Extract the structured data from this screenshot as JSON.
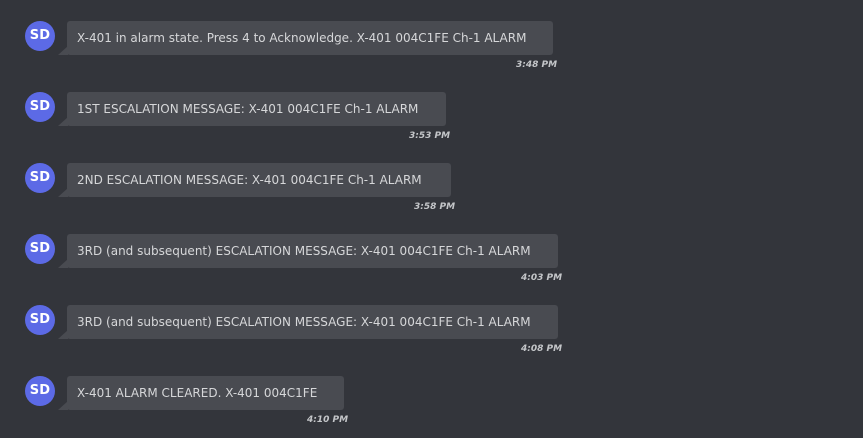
{
  "messages": [
    {
      "avatar": "SD",
      "text": "X-401 in alarm state. Press 4 to Acknowledge. X-401 004C1FE Ch-1 ALARM",
      "time": "3:48 PM"
    },
    {
      "avatar": "SD",
      "text": "1ST ESCALATION MESSAGE: X-401 004C1FE Ch-1 ALARM",
      "time": "3:53 PM"
    },
    {
      "avatar": "SD",
      "text": "2ND ESCALATION MESSAGE: X-401 004C1FE Ch-1 ALARM",
      "time": "3:58 PM"
    },
    {
      "avatar": "SD",
      "text": "3RD (and subsequent) ESCALATION MESSAGE: X-401 004C1FE Ch-1 ALARM",
      "time": "4:03 PM"
    },
    {
      "avatar": "SD",
      "text": "3RD (and subsequent) ESCALATION MESSAGE: X-401 004C1FE Ch-1 ALARM",
      "time": "4:08 PM"
    },
    {
      "avatar": "SD",
      "text": "X-401 ALARM CLEARED. X-401 004C1FE",
      "time": "4:10 PM"
    }
  ]
}
